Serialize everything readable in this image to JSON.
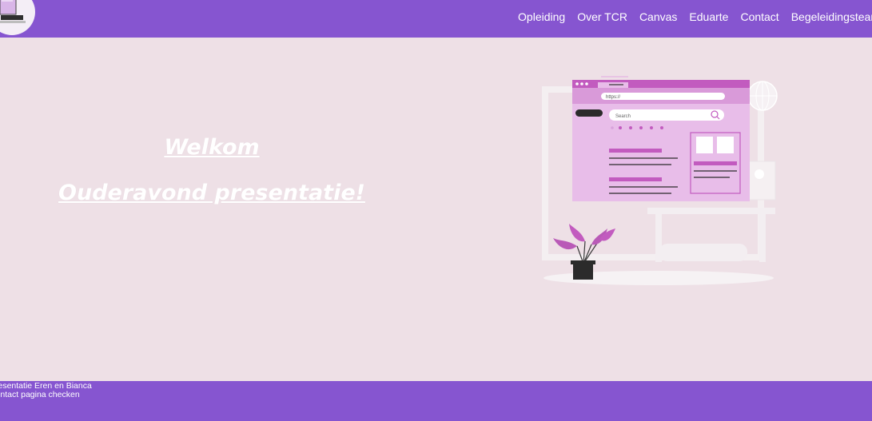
{
  "nav": {
    "items": [
      "Opleiding",
      "Over TCR",
      "Canvas",
      "Eduarte",
      "Contact",
      "Begeleidingsteam"
    ]
  },
  "hero": {
    "title": "Welkom",
    "subtitle": "Ouderavond presentatie!"
  },
  "illustration": {
    "url_text": "https://",
    "search_placeholder": "Search"
  },
  "footer": {
    "lines": [
      "Presentatie Eren en Bianca",
      "Contact pagina checken"
    ]
  },
  "colors": {
    "brand": "#8655d0",
    "background": "#eee0e6",
    "accent_pink": "#c25bbf"
  }
}
